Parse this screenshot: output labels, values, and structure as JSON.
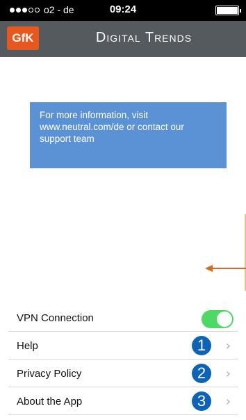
{
  "status_bar": {
    "carrier": "o2 - de",
    "time": "09:24",
    "signal_filled": 3,
    "signal_total": 5,
    "battery_level": 1.0
  },
  "nav": {
    "logo_text": "GfK",
    "title": "Digital Trends"
  },
  "info": {
    "text": "For more information, visit www.neutral.com/de or contact our support team"
  },
  "settings": {
    "rows": [
      {
        "label": "VPN Connection",
        "type": "toggle",
        "enabled": true
      },
      {
        "label": "Help",
        "badge": "1",
        "icon": "chevron-right-icon"
      },
      {
        "label": "Privacy Policy",
        "badge": "2",
        "icon": "chevron-right-icon"
      },
      {
        "label": "About the App",
        "badge": "3",
        "icon": "chevron-right-icon"
      }
    ]
  },
  "colors": {
    "nav_bg": "#555a5f",
    "logo_bg": "#e8581e",
    "info_bg": "#5b92d6",
    "toggle_on": "#4cd964",
    "badge_bg": "#0b64b7",
    "arrow": "#e0661c"
  }
}
